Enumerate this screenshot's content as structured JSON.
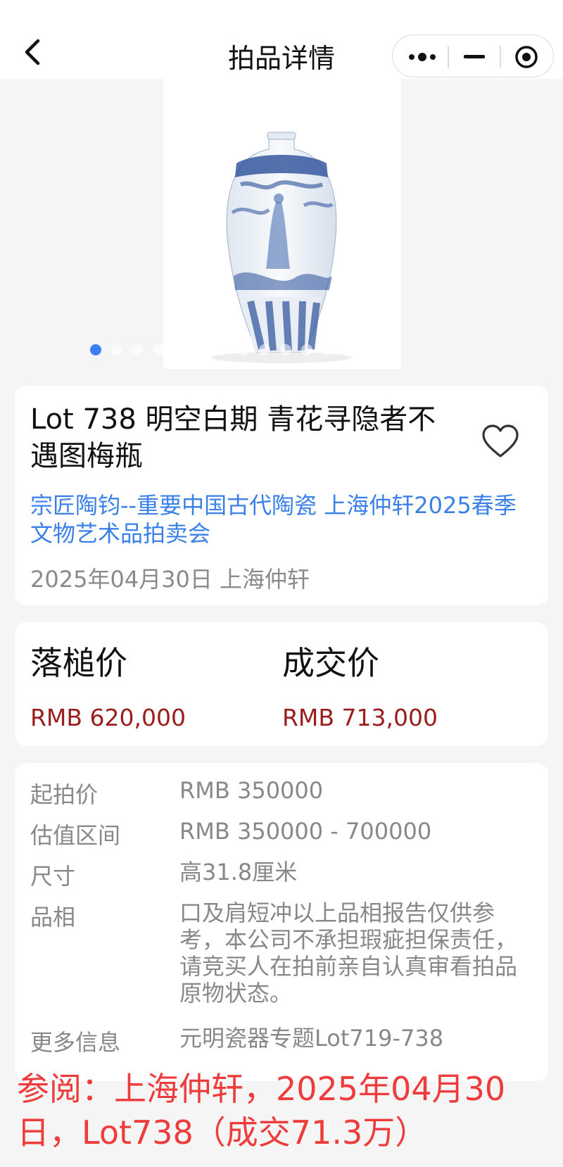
{
  "header": {
    "title": "拍品详情",
    "back_icon": "chevron-left-icon",
    "capsule": {
      "more_icon": "more-dots-icon",
      "minimize_icon": "minimize-icon",
      "close_icon": "target-close-icon"
    }
  },
  "gallery": {
    "image": "blue-and-white-meiping-vase",
    "dot_count": 15,
    "active_index": 0,
    "accent_color": "#3b7ff5"
  },
  "lot": {
    "title": "Lot 738 明空白期 青花寻隐者不遇图梅瓶",
    "favorite_icon": "heart-outline-icon",
    "sale_name": "宗匠陶钧--重要中国古代陶瓷 上海仲轩2025春季文物艺术品拍卖会",
    "sale_meta": "2025年04月30日 上海仲轩"
  },
  "prices": {
    "hammer_label": "落槌价",
    "hammer_value": "RMB 620,000",
    "deal_label": "成交价",
    "deal_value": "RMB 713,000",
    "value_color": "#9b1c1c"
  },
  "details": [
    {
      "key": "起拍价",
      "value": "RMB 350000"
    },
    {
      "key": "估值区间",
      "value": "RMB 350000 - 700000"
    },
    {
      "key": "尺寸",
      "value": "高31.8厘米"
    },
    {
      "key": "品相",
      "value": "口及肩短冲以上品相报告仅供参考，本公司不承担瑕疵担保责任，请竞买人在拍前亲自认真审看拍品原物状态。"
    },
    {
      "key": "更多信息",
      "value": "元明瓷器专题Lot719-738"
    }
  ],
  "overlay_note": "参阅：上海仲轩，2025年04月30日，Lot738（成交71.3万）"
}
